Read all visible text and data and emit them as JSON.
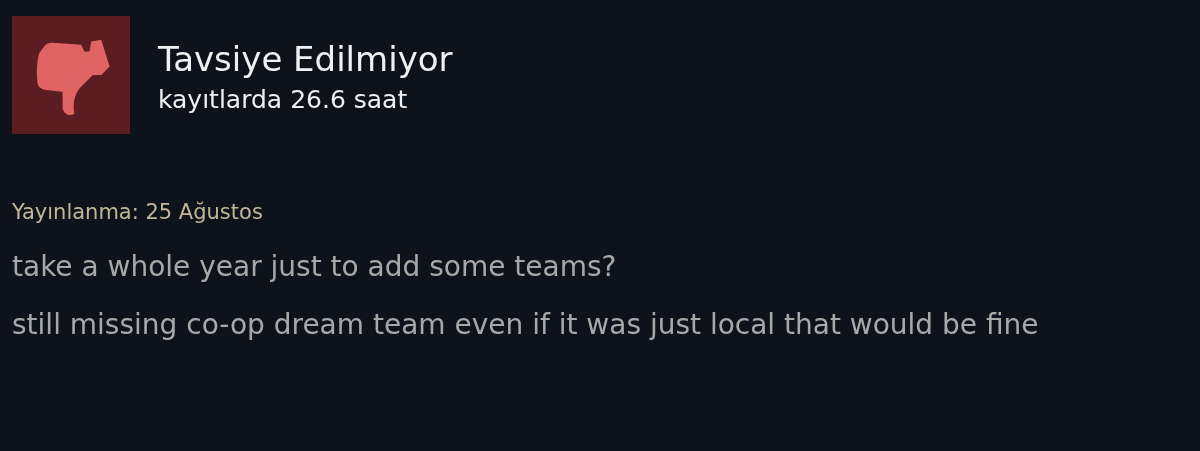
{
  "review": {
    "recommended": false,
    "verdict": "Tavsiye Edilmiyor",
    "hours": "kayıtlarda 26.6 saat",
    "posted": "Yayınlanma: 25 Ağustos",
    "paragraphs": [
      "take a whole year just to add some teams?",
      "still missing co-op dream team even if it was just local that would be fine"
    ]
  }
}
